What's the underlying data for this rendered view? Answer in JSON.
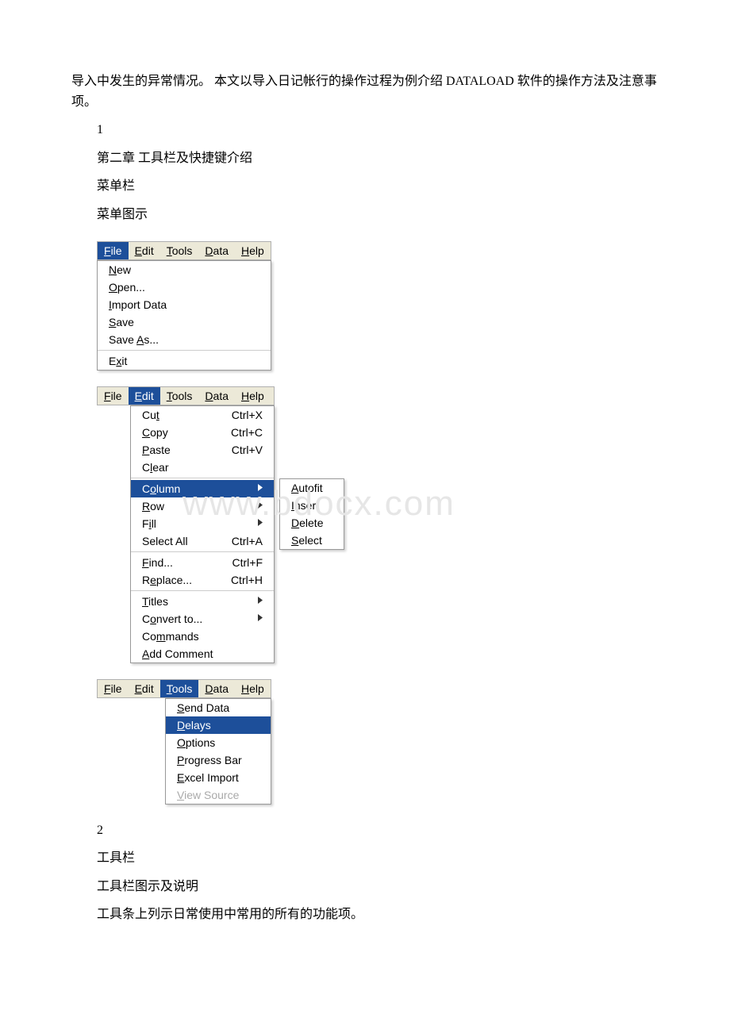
{
  "intro_text": "导入中发生的异常情况。 本文以导入日记帐行的操作过程为例介绍 DATALOAD 软件的操作方法及注意事项。",
  "section1_num": "1",
  "section1_title": "第二章 工具栏及快捷键介绍",
  "menubar_heading": "菜单栏",
  "menubar_caption": "菜单图示",
  "watermark_text": "www.bdocx.com",
  "menubar_items": {
    "file": "File",
    "edit": "Edit",
    "tools": "Tools",
    "data": "Data",
    "help": "Help"
  },
  "file_menu": {
    "new": "New",
    "open": "Open...",
    "import_data": "Import Data",
    "save": "Save",
    "save_as": "Save As...",
    "exit": "Exit"
  },
  "edit_menu": {
    "cut": "Cut",
    "cut_sc": "Ctrl+X",
    "copy": "Copy",
    "copy_sc": "Ctrl+C",
    "paste": "Paste",
    "paste_sc": "Ctrl+V",
    "clear": "Clear",
    "column": "Column",
    "row": "Row",
    "fill": "Fill",
    "select_all": "Select All",
    "select_all_sc": "Ctrl+A",
    "find": "Find...",
    "find_sc": "Ctrl+F",
    "replace": "Replace...",
    "replace_sc": "Ctrl+H",
    "titles": "Titles",
    "convert_to": "Convert to...",
    "commands": "Commands",
    "add_comment": "Add Comment"
  },
  "column_submenu": {
    "autofit": "Autofit",
    "insert": "Insert",
    "delete": "Delete",
    "select": "Select"
  },
  "tools_menu": {
    "send_data": "Send Data",
    "delays": "Delays",
    "options": "Options",
    "progress_bar": "Progress Bar",
    "excel_import": "Excel Import",
    "view_source": "View Source"
  },
  "section2_num": "2",
  "toolbar_heading": "工具栏",
  "toolbar_caption": "工具栏图示及说明",
  "toolbar_desc": "工具条上列示日常使用中常用的所有的功能项。"
}
